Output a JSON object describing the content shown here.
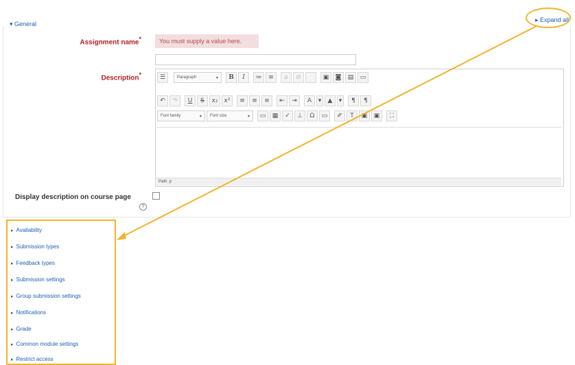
{
  "general": {
    "legend": "General",
    "expand_all": "Expand all"
  },
  "assignment_name": {
    "label": "Assignment name",
    "error": "You must supply a value here.",
    "value": ""
  },
  "description": {
    "label": "Description",
    "toolbar": {
      "paragraph": "Paragraph",
      "font_family": "Font family",
      "font_size": "Font size"
    },
    "status_path": "Path: p"
  },
  "display_description": {
    "label": "Display description on course page"
  },
  "sections": [
    "Availability",
    "Submission types",
    "Feedback types",
    "Submission settings",
    "Group submission settings",
    "Notifications",
    "Grade",
    "Common module settings",
    "Restrict access"
  ],
  "colors": {
    "required": "#b52025",
    "link": "#1a5fb4",
    "highlight": "#f0b429",
    "error_bg": "#f2dede"
  }
}
